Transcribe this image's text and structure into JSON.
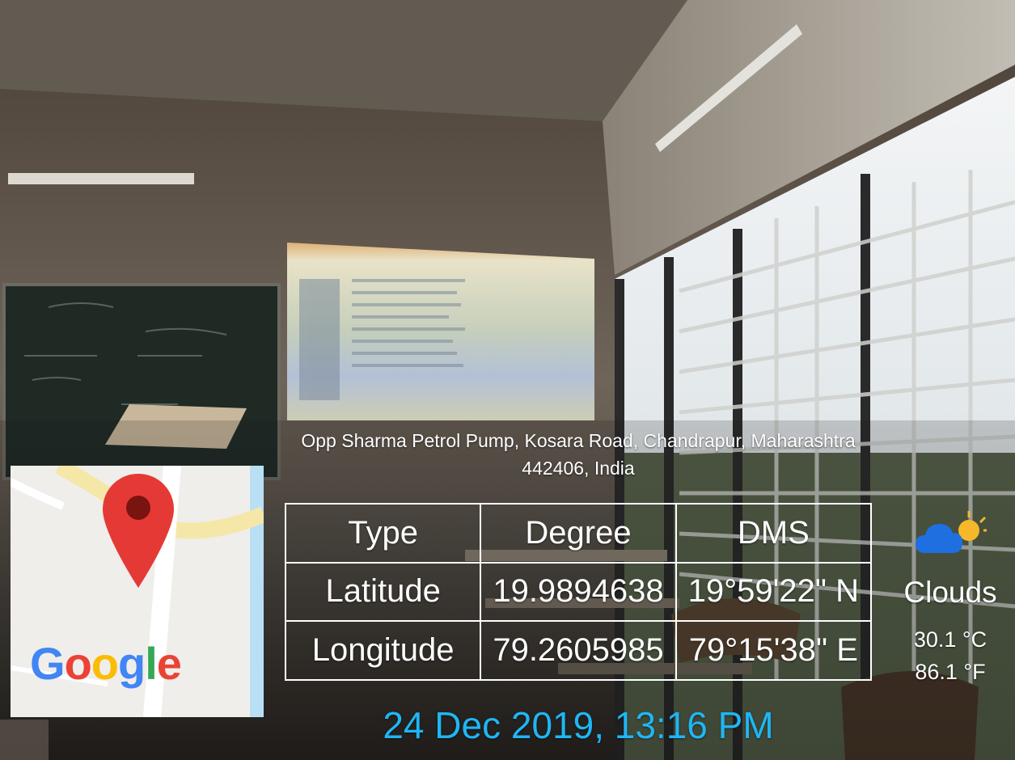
{
  "address": {
    "line1": "Opp Sharma Petrol Pump, Kosara Road, Chandrapur, Maharashtra",
    "line2": "442406, India"
  },
  "coordinates": {
    "headers": [
      "Type",
      "Degree",
      "DMS"
    ],
    "rows": [
      {
        "type": "Latitude",
        "degree": "19.9894638",
        "dms": "19°59'22\" N"
      },
      {
        "type": "Longitude",
        "degree": "79.2605985",
        "dms": "79°15'38\" E"
      }
    ]
  },
  "map": {
    "brand": "Google",
    "pin_color": "#e53935",
    "pin_icon": "map-pin-icon"
  },
  "weather": {
    "icon": "cloud-sun-icon",
    "condition": "Clouds",
    "temp_c": "30.1 °C",
    "temp_f": "86.1 °F"
  },
  "timestamp": "24 Dec 2019, 13:16 PM",
  "colors": {
    "timestamp": "#1fb6f5",
    "text": "#ffffff",
    "google_blue": "#4285F4",
    "google_red": "#EA4335",
    "google_yellow": "#FBBC05",
    "google_green": "#34A853"
  }
}
